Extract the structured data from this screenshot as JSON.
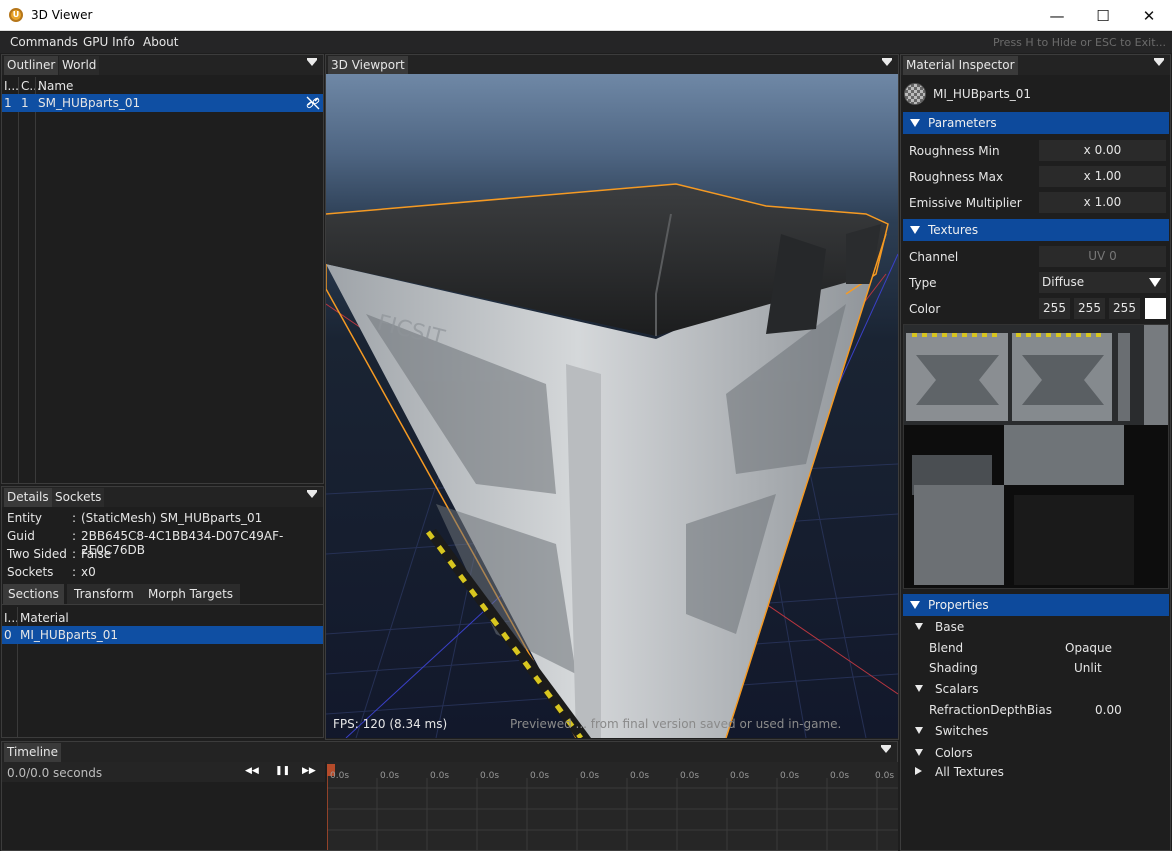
{
  "window": {
    "title": "3D Viewer",
    "icon": "ue-logo-icon",
    "minimize": "—",
    "maximize": "☐",
    "close": "✕"
  },
  "menu": {
    "items": [
      "Commands",
      "GPU Info",
      "About"
    ],
    "hint": "Press H to Hide or ESC to Exit..."
  },
  "outliner": {
    "tabs": [
      "Outliner",
      "World"
    ],
    "columns": [
      "I...",
      "C...",
      "Name"
    ],
    "rows": [
      {
        "i": "1",
        "c": "1",
        "name": "SM_HUBparts_01",
        "icon": "unlink-icon"
      }
    ]
  },
  "details": {
    "tabs": [
      "Details",
      "Sockets"
    ],
    "rows": [
      {
        "key": "Entity",
        "sep": ":",
        "value": "(StaticMesh) SM_HUBparts_01"
      },
      {
        "key": "Guid",
        "sep": ":",
        "value": "2BB645C8-4C1BB434-D07C49AF-2E0C76DB"
      },
      {
        "key": "Two Sided",
        "sep": ":",
        "value": "False"
      },
      {
        "key": "Sockets",
        "sep": ":",
        "value": "x0"
      }
    ],
    "subtabs": [
      "Sections",
      "Transform",
      "Morph Targets"
    ],
    "section_columns": [
      "I...",
      "Material"
    ],
    "section_rows": [
      {
        "i": "0",
        "material": "MI_HUBparts_01"
      }
    ]
  },
  "viewport": {
    "tab": "3D Viewport",
    "fps": "FPS: 120 (8.34 ms)",
    "preview_note": "Previewed ... from final version saved or used in-game."
  },
  "inspector": {
    "tab": "Material Inspector",
    "material_name": "MI_HUBparts_01",
    "parameters_label": "Parameters",
    "params": [
      {
        "label": "Roughness Min",
        "value": "x 0.00"
      },
      {
        "label": "Roughness Max",
        "value": "x 1.00"
      },
      {
        "label": "Emissive Multiplier",
        "value": "x 1.00"
      }
    ],
    "textures_label": "Textures",
    "channel_label": "Channel",
    "channel_value": "UV 0",
    "type_label": "Type",
    "type_value": "Diffuse",
    "color_label": "Color",
    "color_values": [
      "255",
      "255",
      "255"
    ],
    "properties_label": "Properties",
    "tree": {
      "base": "Base",
      "blend_label": "Blend",
      "blend_value": "Opaque",
      "shading_label": "Shading",
      "shading_value": "Unlit",
      "scalars": "Scalars",
      "refraction_label": "RefractionDepthBias",
      "refraction_value": "0.00",
      "switches": "Switches",
      "colors": "Colors",
      "all_textures": "All Textures"
    }
  },
  "timeline": {
    "tab": "Timeline",
    "time": "0.0/0.0 seconds",
    "controls": [
      "◀◀",
      "❚❚",
      "▶▶"
    ],
    "ticks": [
      "0.0s",
      "0.0s",
      "0.0s",
      "0.0s",
      "0.0s",
      "0.0s",
      "0.0s",
      "0.0s",
      "0.0s",
      "0.0s",
      "0.0s",
      "0.0s"
    ]
  },
  "colors": {
    "selection": "#0f4fa3",
    "section_header": "#0d4a9c",
    "outline": "#f59a23"
  }
}
